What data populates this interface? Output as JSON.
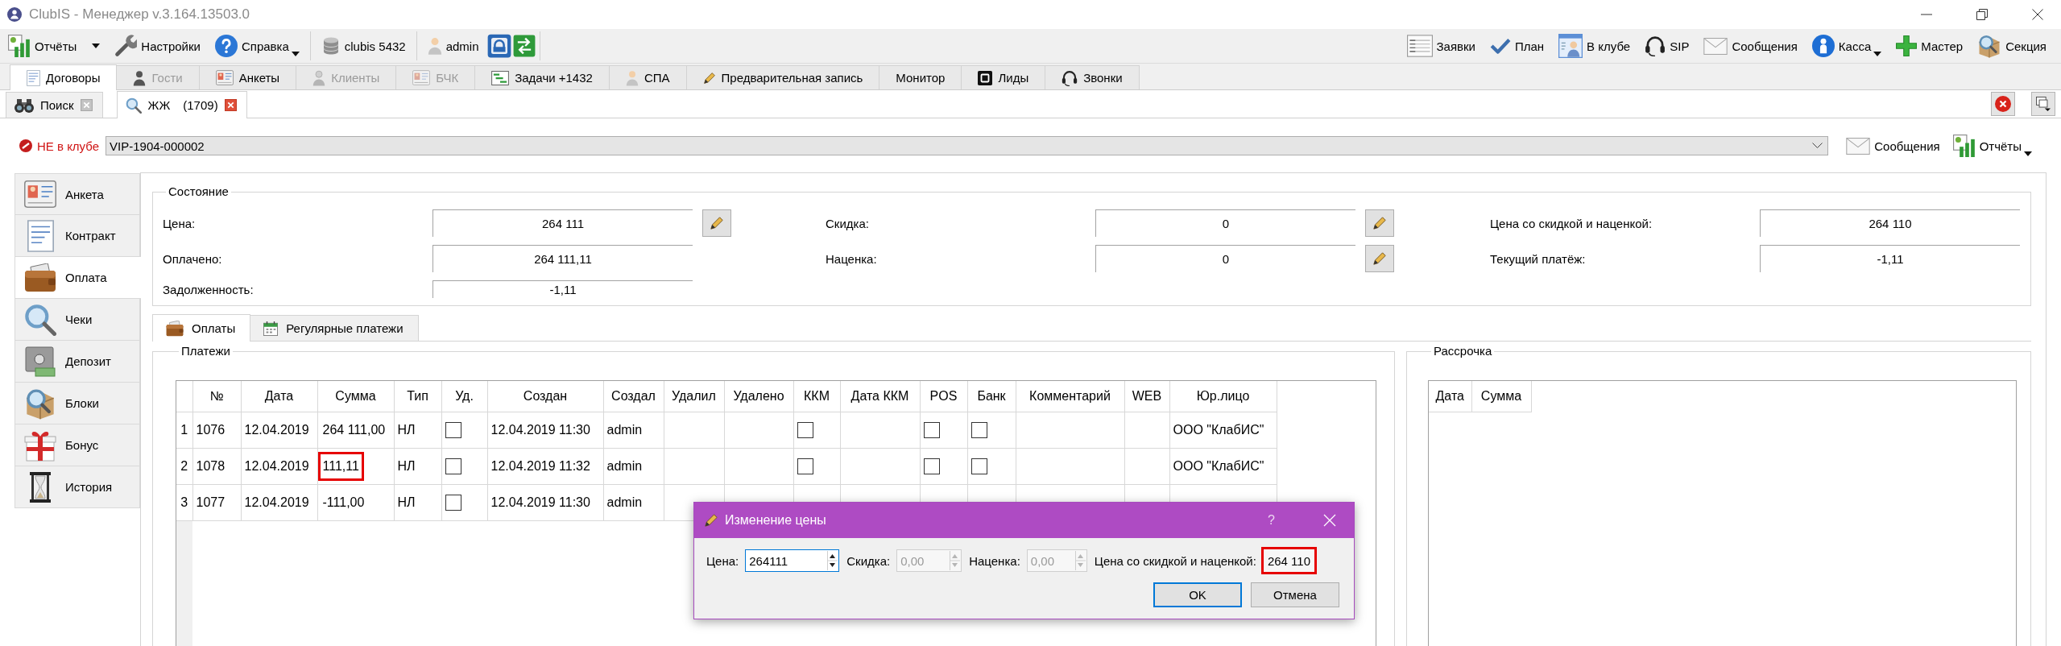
{
  "window": {
    "title": "ClubIS - Менеджер v.3.164.13503.0"
  },
  "toolbar": {
    "left": [
      [
        {
          "kind": "button",
          "label": "Отчёты",
          "split_arrow": true
        },
        {
          "kind": "button",
          "label": "Настройки"
        },
        {
          "kind": "button",
          "label": "Справка",
          "dropdown": true
        }
      ],
      [
        {
          "kind": "button",
          "label": "clubis 5432"
        }
      ],
      [
        {
          "kind": "button",
          "label": "admin"
        },
        {
          "kind": "icon"
        },
        {
          "kind": "icon"
        }
      ]
    ],
    "right": [
      {
        "kind": "button",
        "label": "Заявки"
      },
      {
        "kind": "button",
        "label": "План"
      },
      {
        "kind": "button",
        "label": "В клубе"
      },
      {
        "kind": "button",
        "label": "SIP"
      },
      {
        "kind": "button",
        "label": "Сообщения"
      },
      {
        "kind": "button",
        "label": "Касса",
        "dropdown": true
      },
      {
        "kind": "button",
        "label": "Мастер"
      },
      {
        "kind": "button",
        "label": "Секция"
      }
    ]
  },
  "module_tabs": [
    {
      "label": "Договоры",
      "selected": true,
      "disabled": false
    },
    {
      "label": "Гости",
      "selected": false,
      "disabled": true
    },
    {
      "label": "Анкеты",
      "selected": false,
      "disabled": false
    },
    {
      "label": "Клиенты",
      "selected": false,
      "disabled": true
    },
    {
      "label": "БЧК",
      "selected": false,
      "disabled": true
    },
    {
      "label": "Задачи +1432",
      "selected": false,
      "disabled": false
    },
    {
      "label": "СПА",
      "selected": false,
      "disabled": false
    },
    {
      "label": "Предварительная запись",
      "selected": false,
      "disabled": false
    },
    {
      "label": "Монитор",
      "selected": false,
      "disabled": false
    },
    {
      "label": "Лиды",
      "selected": false,
      "disabled": false
    },
    {
      "label": "Звонки",
      "selected": false,
      "disabled": false
    }
  ],
  "document_tabs": [
    {
      "label": "Поиск",
      "selected": false
    },
    {
      "label": "ЖЖ",
      "count": "(1709)",
      "selected": true
    }
  ],
  "client": {
    "status": "НЕ в клубе",
    "in_club": false,
    "contract": "VIP-1904-000002",
    "actions": [
      {
        "label": "Сообщения"
      },
      {
        "label": "Отчёты",
        "dropdown": true
      }
    ]
  },
  "sidebar": {
    "items": [
      {
        "label": "Анкета",
        "selected": false
      },
      {
        "label": "Контракт",
        "selected": false
      },
      {
        "label": "Оплата",
        "selected": true
      },
      {
        "label": "Чеки",
        "selected": false
      },
      {
        "label": "Депозит",
        "selected": false
      },
      {
        "label": "Блоки",
        "selected": false
      },
      {
        "label": "Бонус",
        "selected": false
      },
      {
        "label": "История",
        "selected": false
      }
    ]
  },
  "state": {
    "title": "Состояние",
    "columns": [
      [
        {
          "label": "Цена:",
          "value": "264 111",
          "editable": true
        },
        {
          "label": "Оплачено:",
          "value": "264 111,11",
          "editable": false
        },
        {
          "label": "Задолженность:",
          "value": "-1,11",
          "editable": false
        }
      ],
      [
        {
          "label": "Скидка:",
          "value": "0",
          "editable": true
        },
        {
          "label": "Наценка:",
          "value": "0",
          "editable": true
        }
      ],
      [
        {
          "label": "Цена со скидкой и наценкой:",
          "value": "264 110",
          "editable": false
        },
        {
          "label": "Текущий платёж:",
          "value": "-1,11",
          "editable": false
        }
      ]
    ]
  },
  "sub_tabs": [
    {
      "label": "Оплаты",
      "selected": true
    },
    {
      "label": "Регулярные платежи",
      "selected": false
    }
  ],
  "payments": {
    "title": "Платежи",
    "columns": [
      "№",
      "Дата",
      "Сумма",
      "Тип",
      "Уд.",
      "Создан",
      "Создал",
      "Удалил",
      "Удалено",
      "ККМ",
      "Дата ККМ",
      "POS",
      "Банк",
      "Комментарий",
      "WEB",
      "Юр.лицо"
    ],
    "rows": [
      {
        "number": "1",
        "no": "1076",
        "date": "12.04.2019",
        "sum": "264 111,00",
        "sum_marked": false,
        "type": "НЛ",
        "deleted": false,
        "created": "12.04.2019 11:30",
        "creator": "admin",
        "kkm": false,
        "pos": false,
        "bank": false,
        "company": "ООО \"КлабИС\""
      },
      {
        "number": "2",
        "no": "1078",
        "date": "12.04.2019",
        "sum": "111,11",
        "sum_marked": true,
        "type": "НЛ",
        "deleted": false,
        "created": "12.04.2019 11:32",
        "creator": "admin",
        "kkm": false,
        "pos": false,
        "bank": false,
        "company": "ООО \"КлабИС\""
      },
      {
        "number": "3",
        "no": "1077",
        "date": "12.04.2019",
        "sum": "-111,00",
        "sum_marked": false,
        "type": "НЛ",
        "deleted": false,
        "created": "12.04.2019 11:30",
        "creator": "admin"
      }
    ]
  },
  "installments": {
    "title": "Рассрочка",
    "columns": [
      "Дата",
      "Сумма"
    ]
  },
  "dialog": {
    "title": "Изменение цены",
    "help": "?",
    "fields": [
      {
        "label": "Цена:",
        "value": "264111",
        "disabled": false,
        "focused": true
      },
      {
        "label": "Скидка:",
        "value": "0,00",
        "disabled": true,
        "focused": false
      },
      {
        "label": "Наценка:",
        "value": "0,00",
        "disabled": true,
        "focused": false
      }
    ],
    "result": {
      "label": "Цена со скидкой и наценкой:",
      "value": "264 110",
      "marked": true
    },
    "buttons": [
      {
        "label": "OK",
        "default": true
      },
      {
        "label": "Отмена",
        "default": false
      }
    ]
  }
}
